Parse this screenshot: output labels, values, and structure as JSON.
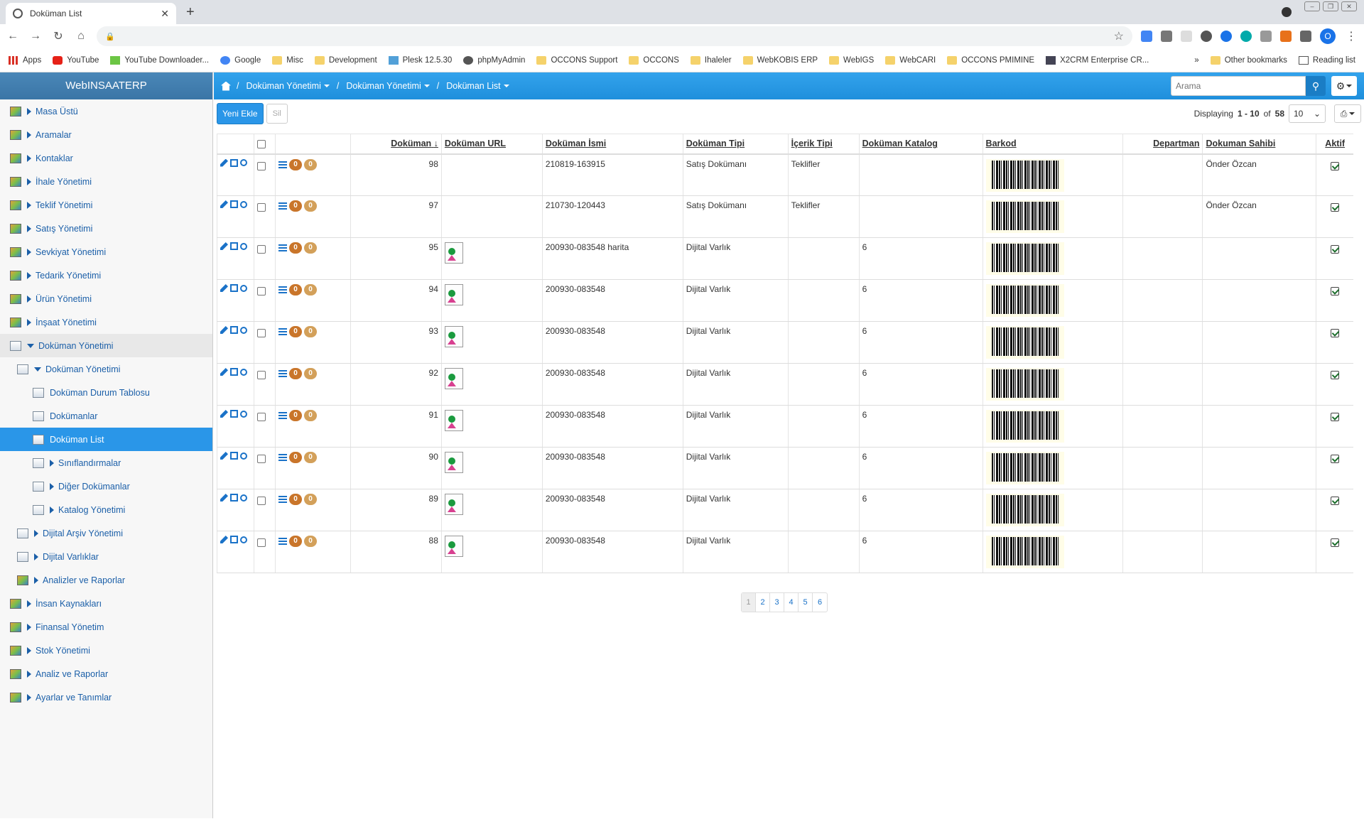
{
  "browser": {
    "tab_title": "Doküman List",
    "bookmarks": [
      "Apps",
      "YouTube",
      "YouTube Downloader...",
      "Google",
      "Misc",
      "Development",
      "Plesk 12.5.30",
      "phpMyAdmin",
      "OCCONS Support",
      "OCCONS",
      "Ihaleler",
      "WebKOBIS ERP",
      "WebIGS",
      "WebCARI",
      "OCCONS PMIMINE",
      "X2CRM Enterprise CR..."
    ],
    "more_bookmarks": "»",
    "other_bookmarks": "Other bookmarks",
    "reading_list": "Reading list",
    "profile_letter": "O"
  },
  "brand": "WebINSAATERP",
  "sidebar": {
    "items": [
      {
        "label": "Masa Üstü"
      },
      {
        "label": "Aramalar"
      },
      {
        "label": "Kontaklar"
      },
      {
        "label": "İhale Yönetimi"
      },
      {
        "label": "Teklif Yönetimi"
      },
      {
        "label": "Satış Yönetimi"
      },
      {
        "label": "Sevkiyat Yönetimi"
      },
      {
        "label": "Tedarik Yönetimi"
      },
      {
        "label": "Ürün Yönetimi"
      },
      {
        "label": "İnşaat Yönetimi"
      },
      {
        "label": "Doküman Yönetimi"
      },
      {
        "label": "Doküman Yönetimi"
      },
      {
        "label": "Doküman Durum Tablosu"
      },
      {
        "label": "Dokümanlar"
      },
      {
        "label": "Doküman List"
      },
      {
        "label": "Sınıflandırmalar"
      },
      {
        "label": "Diğer Dokümanlar"
      },
      {
        "label": "Katalog Yönetimi"
      },
      {
        "label": "Dijital Arşiv Yönetimi"
      },
      {
        "label": "Dijital Varlıklar"
      },
      {
        "label": "Analizler ve Raporlar"
      },
      {
        "label": "İnsan Kaynakları"
      },
      {
        "label": "Finansal Yönetim"
      },
      {
        "label": "Stok Yönetimi"
      },
      {
        "label": "Analiz ve Raporlar"
      },
      {
        "label": "Ayarlar ve Tanımlar"
      }
    ]
  },
  "breadcrumb": [
    "Doküman Yönetimi",
    "Doküman Yönetimi",
    "Doküman List"
  ],
  "search": {
    "placeholder": "Arama"
  },
  "actions": {
    "new_label": "Yeni Ekle",
    "delete_label": "Sil"
  },
  "paging": {
    "displaying_prefix": "Displaying",
    "range": "1 - 10",
    "of_label": "of",
    "total": "58",
    "page_size": "10"
  },
  "table": {
    "headers": [
      "Doküman",
      "Doküman URL",
      "Doküman İsmi",
      "Doküman Tipi",
      "İçerik Tipi",
      "Doküman Katalog",
      "Barkod",
      "Departman",
      "Dokuman Sahibi",
      "Aktif"
    ],
    "badge_a": "0",
    "badge_b": "0",
    "rows": [
      {
        "id": "98",
        "url": false,
        "name": "210819-163915",
        "type": "Satış Dokümanı",
        "content": "Teklifler",
        "catalog": "",
        "owner": "Önder Özcan"
      },
      {
        "id": "97",
        "url": false,
        "name": "210730-120443",
        "type": "Satış Dokümanı",
        "content": "Teklifler",
        "catalog": "",
        "owner": "Önder Özcan"
      },
      {
        "id": "95",
        "url": true,
        "name": "200930-083548 harita",
        "type": "Dijital Varlık",
        "content": "",
        "catalog": "6",
        "owner": ""
      },
      {
        "id": "94",
        "url": true,
        "name": "200930-083548",
        "type": "Dijital Varlık",
        "content": "",
        "catalog": "6",
        "owner": ""
      },
      {
        "id": "93",
        "url": true,
        "name": "200930-083548",
        "type": "Dijital Varlık",
        "content": "",
        "catalog": "6",
        "owner": ""
      },
      {
        "id": "92",
        "url": true,
        "name": "200930-083548",
        "type": "Dijital Varlık",
        "content": "",
        "catalog": "6",
        "owner": ""
      },
      {
        "id": "91",
        "url": true,
        "name": "200930-083548",
        "type": "Dijital Varlık",
        "content": "",
        "catalog": "6",
        "owner": ""
      },
      {
        "id": "90",
        "url": true,
        "name": "200930-083548",
        "type": "Dijital Varlık",
        "content": "",
        "catalog": "6",
        "owner": ""
      },
      {
        "id": "89",
        "url": true,
        "name": "200930-083548",
        "type": "Dijital Varlık",
        "content": "",
        "catalog": "6",
        "owner": ""
      },
      {
        "id": "88",
        "url": true,
        "name": "200930-083548",
        "type": "Dijital Varlık",
        "content": "",
        "catalog": "6",
        "owner": ""
      }
    ]
  },
  "pager": [
    "1",
    "2",
    "3",
    "4",
    "5",
    "6"
  ],
  "colors": {
    "accent": "#2a96e8",
    "brand_bar": "#3a75a6",
    "badge_dark": "#c9752a",
    "badge_light": "#d3a05a"
  }
}
